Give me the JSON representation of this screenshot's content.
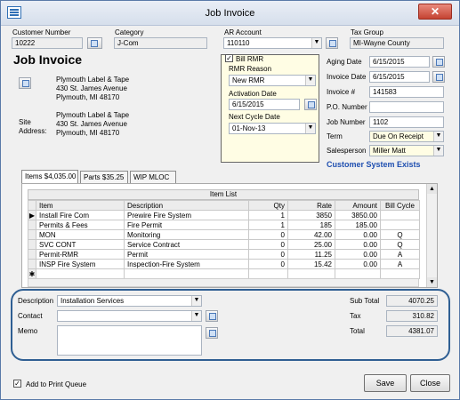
{
  "window": {
    "title": "Job Invoice",
    "close_glyph": "✕"
  },
  "header": {
    "customer_number": {
      "label": "Customer Number",
      "value": "10222"
    },
    "category": {
      "label": "Category",
      "value": "J-Com"
    },
    "ar_account": {
      "label": "AR Account",
      "value": "110110"
    },
    "tax_group": {
      "label": "Tax Group",
      "value": "MI-Wayne County"
    }
  },
  "invoice": {
    "heading": "Job Invoice",
    "bill_to": {
      "name": "Plymouth Label & Tape",
      "street": "430 St. James Avenue",
      "city": "Plymouth, MI  48170"
    },
    "site_label_1": "Site",
    "site_label_2": "Address:",
    "site": {
      "name": "Plymouth Label & Tape",
      "street": "430 St. James Avenue",
      "city": "Plymouth, MI  48170"
    }
  },
  "rmr": {
    "bill_label": "Bill RMR",
    "bill_checked": true,
    "reason_label": "RMR Reason",
    "reason_value": "New RMR",
    "activation_label": "Activation Date",
    "activation_value": "6/15/2015",
    "next_cycle_label": "Next Cycle Date",
    "next_cycle_value": "01-Nov-13"
  },
  "right_fields": {
    "aging_date": {
      "label": "Aging Date",
      "value": "6/15/2015"
    },
    "invoice_date": {
      "label": "Invoice Date",
      "value": "6/15/2015"
    },
    "invoice_number": {
      "label": "Invoice #",
      "value": "141583"
    },
    "po_number": {
      "label": "P.O. Number",
      "value": ""
    },
    "job_number": {
      "label": "Job Number",
      "value": "1102"
    },
    "term": {
      "label": "Term",
      "value": "Due On Receipt"
    },
    "salesperson": {
      "label": "Salesperson",
      "value": "Miller Matt"
    },
    "system_link": "Customer System Exists"
  },
  "tabs": [
    {
      "label": "Items  $4,035.00"
    },
    {
      "label": "Parts  $35.25"
    },
    {
      "label": "WIP MLOC"
    }
  ],
  "grid": {
    "title": "Item List",
    "columns": [
      "Item",
      "Description",
      "Qty",
      "Rate",
      "Amount",
      "Bill Cycle"
    ],
    "rows": [
      {
        "marker": "▶",
        "item": "Install Fire Com",
        "description": "Prewire Fire System",
        "qty": "1",
        "rate": "3850",
        "amount": "3850.00",
        "cycle": ""
      },
      {
        "marker": "",
        "item": "Permits & Fees",
        "description": "Fire Permit",
        "qty": "1",
        "rate": "185",
        "amount": "185.00",
        "cycle": ""
      },
      {
        "marker": "",
        "item": "MON",
        "description": "Monitoring",
        "qty": "0",
        "rate": "42.00",
        "amount": "0.00",
        "cycle": "Q"
      },
      {
        "marker": "",
        "item": "SVC CONT",
        "description": "Service Contract",
        "qty": "0",
        "rate": "25.00",
        "amount": "0.00",
        "cycle": "Q"
      },
      {
        "marker": "",
        "item": "Permit-RMR",
        "description": "Permit",
        "qty": "0",
        "rate": "11.25",
        "amount": "0.00",
        "cycle": "A"
      },
      {
        "marker": "",
        "item": "INSP Fire System",
        "description": "Inspection-Fire System",
        "qty": "0",
        "rate": "15.42",
        "amount": "0.00",
        "cycle": "A"
      },
      {
        "marker": "✱",
        "item": "",
        "description": "",
        "qty": "",
        "rate": "",
        "amount": "",
        "cycle": ""
      }
    ]
  },
  "bottom": {
    "description": {
      "label": "Description",
      "value": "Installation Services"
    },
    "contact": {
      "label": "Contact",
      "value": ""
    },
    "memo": {
      "label": "Memo",
      "value": ""
    },
    "sub_total": {
      "label": "Sub Total",
      "value": "4070.25"
    },
    "tax": {
      "label": "Tax",
      "value": "310.82"
    },
    "total": {
      "label": "Total",
      "value": "4381.07"
    }
  },
  "footer": {
    "print_queue_label": "Add to Print Queue",
    "print_queue_checked": true,
    "save_label": "Save",
    "close_label": "Close"
  }
}
